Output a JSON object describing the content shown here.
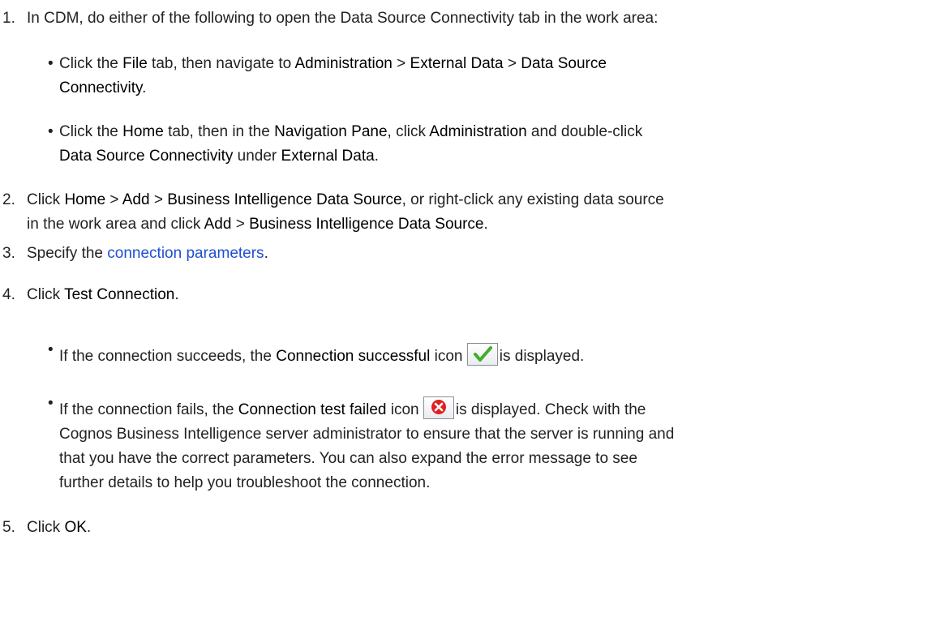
{
  "steps": [
    {
      "number": "1.",
      "segments": [
        "In CDM, do either of the following to open the Data Source Connectivity tab in the work area:"
      ],
      "subs": [
        {
          "line1": [
            "Click the ",
            "File",
            " tab, then navigate to ",
            "Administration",
            " > ",
            "External Data",
            " > ",
            "Data Source"
          ],
          "line2": [
            "Connectivity",
            "."
          ]
        },
        {
          "line1": [
            "Click the ",
            "Home",
            " tab, then in the ",
            "Navigation Pane",
            ", click ",
            "Administration",
            " and double-click"
          ],
          "line2": [
            "Data Source Connectivity",
            " under ",
            "External Data",
            "."
          ]
        }
      ]
    },
    {
      "number": "2.",
      "line1": [
        "Click ",
        "Home",
        " > ",
        "Add",
        " > ",
        "Business Intelligence Data Source",
        ", or right-click any existing data source"
      ],
      "line2": [
        "in the work area and click ",
        "Add",
        " > ",
        "Business Intelligence Data Source",
        "."
      ]
    },
    {
      "number": "3.",
      "segments": [
        "Specify the ",
        "connection parameters",
        "."
      ]
    },
    {
      "number": "4.",
      "segments": [
        "Click ",
        "Test Connection",
        "."
      ],
      "subs": [
        {
          "parts": [
            "If the connection succeeds, the ",
            "Connection successful",
            " icon ",
            "is displayed."
          ]
        },
        {
          "line1": [
            "If the connection fails, the ",
            "Connection test failed",
            " icon ",
            "is displayed. Check with the"
          ],
          "line2": "Cognos Business Intelligence server administrator to ensure that the server is running and",
          "line3": "that you have the correct parameters. You can also expand the error message to see",
          "line4": "further details to help you troubleshoot the connection."
        }
      ]
    },
    {
      "number": "5.",
      "segments": [
        "Click ",
        "OK",
        "."
      ]
    }
  ],
  "icons": {
    "success": "check-mark-icon",
    "failure": "error-x-icon",
    "success_color": "#3fae29",
    "failure_color": "#e02020"
  },
  "colors": {
    "text": "#222222",
    "link": "#1f4fd1"
  }
}
